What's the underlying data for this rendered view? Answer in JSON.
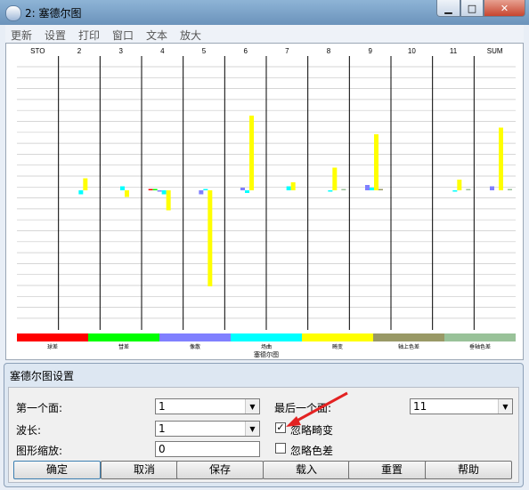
{
  "window": {
    "title": "2: 塞德尔图"
  },
  "menu": [
    "更新",
    "设置",
    "打印",
    "窗口",
    "文本",
    "放大"
  ],
  "chart_data": {
    "type": "bar",
    "title": "塞德尔图",
    "columns": [
      "STO",
      "2",
      "3",
      "4",
      "5",
      "6",
      "7",
      "8",
      "9",
      "10",
      "11",
      "SUM"
    ],
    "legend": [
      {
        "label": "球差",
        "color": "#ff0000"
      },
      {
        "label": "彗差",
        "color": "#00ff00"
      },
      {
        "label": "像散",
        "color": "#8080ff"
      },
      {
        "label": "场曲",
        "color": "#00ffff"
      },
      {
        "label": "畸变",
        "color": "#ffff00"
      },
      {
        "label": "轴上色差",
        "color": "#999966"
      },
      {
        "label": "垂轴色差",
        "color": "#99c299"
      }
    ],
    "series": [
      {
        "name": "球差",
        "values": [
          0,
          0,
          0,
          0.01,
          0,
          0,
          0,
          0,
          0,
          0,
          0,
          0
        ]
      },
      {
        "name": "彗差",
        "values": [
          0,
          0,
          0,
          0.01,
          0,
          0,
          0,
          0,
          0,
          0,
          0,
          0
        ]
      },
      {
        "name": "像散",
        "values": [
          0,
          0,
          0,
          -0.01,
          -0.03,
          0.02,
          0,
          0,
          0.04,
          0,
          0,
          0.03
        ]
      },
      {
        "name": "场曲",
        "values": [
          0,
          -0.03,
          0.03,
          -0.03,
          0.01,
          -0.02,
          0.03,
          -0.01,
          0.02,
          0,
          -0.01,
          0
        ]
      },
      {
        "name": "畸变",
        "values": [
          0,
          0.09,
          -0.05,
          -0.15,
          -0.72,
          0.56,
          0.06,
          0.17,
          0.42,
          0,
          0.08,
          0.47
        ]
      },
      {
        "name": "轴上色差",
        "values": [
          0,
          0,
          0,
          0,
          0,
          0,
          0,
          0,
          0.01,
          0,
          0,
          0
        ]
      },
      {
        "name": "垂轴色差",
        "values": [
          0,
          0,
          0,
          0,
          0,
          0,
          0,
          0.01,
          0,
          0,
          0.01,
          0.01
        ]
      }
    ]
  },
  "dialog": {
    "title": "塞德尔图设置",
    "first_surface_label": "第一个面:",
    "first_surface_value": "1",
    "last_surface_label": "最后一个面:",
    "last_surface_value": "11",
    "wavelength_label": "波长:",
    "wavelength_value": "1",
    "ignore_distortion_label": "忽略畸变",
    "ignore_distortion_checked": true,
    "scale_label": "图形缩放:",
    "scale_value": "0",
    "ignore_color_label": "忽略色差",
    "ignore_color_checked": false,
    "buttons": {
      "ok": "确定",
      "cancel": "取消",
      "save": "保存",
      "load": "载入",
      "reset": "重置",
      "help": "帮助"
    }
  }
}
